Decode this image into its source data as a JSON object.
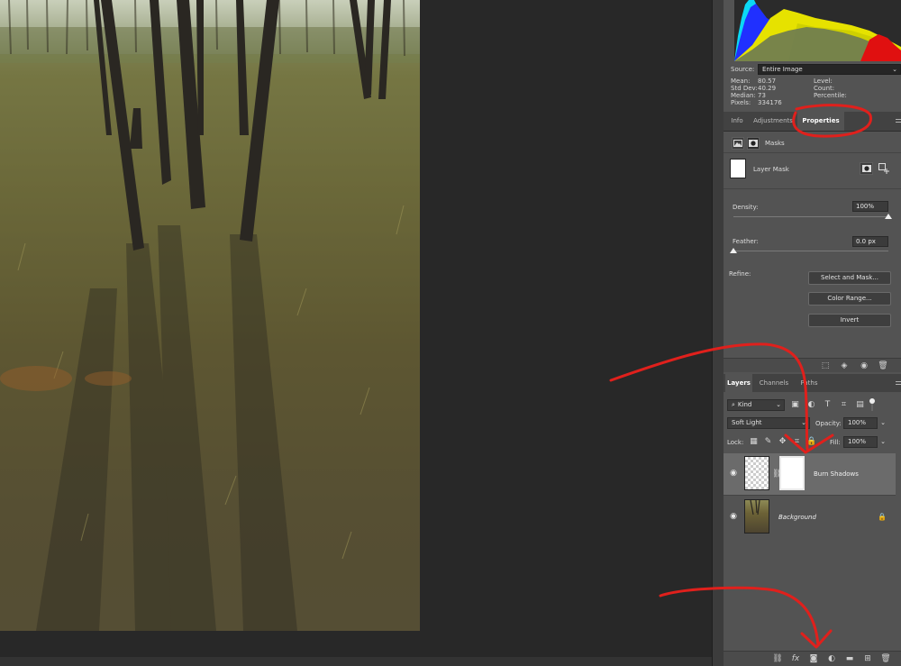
{
  "histogram": {
    "source_label": "Source:",
    "source_value": "Entire Image",
    "stats_left": [
      {
        "label": "Mean:",
        "value": "80.57"
      },
      {
        "label": "Std Dev:",
        "value": "40.29"
      },
      {
        "label": "Median:",
        "value": "73"
      },
      {
        "label": "Pixels:",
        "value": "334176"
      }
    ],
    "stats_right": [
      "Level:",
      "Count:",
      "Percentile:"
    ]
  },
  "top_tabs": {
    "tab1": "Info",
    "tab2": "Adjustments",
    "tab3": "Properties"
  },
  "properties": {
    "masks_label": "Masks",
    "layer_mask_label": "Layer Mask",
    "density_label": "Density:",
    "density_value": "100%",
    "density_fraction": 1.0,
    "feather_label": "Feather:",
    "feather_value": "0.0 px",
    "feather_fraction": 0.0,
    "refine_label": "Refine:",
    "btn_select_mask": "Select and Mask...",
    "btn_color_range": "Color Range...",
    "btn_invert": "Invert"
  },
  "layer_tabs": {
    "tab1": "Layers",
    "tab2": "Channels",
    "tab3": "Paths"
  },
  "layers_panel": {
    "filter_kind": "Kind",
    "blend_mode": "Soft Light",
    "opacity_label": "Opacity:",
    "opacity_value": "100%",
    "lock_label": "Lock:",
    "fill_label": "Fill:",
    "fill_value": "100%",
    "layers": [
      {
        "name": "Burn Shadows",
        "selected": true
      },
      {
        "name": "Background",
        "selected": false
      }
    ]
  },
  "colors": {
    "annotation_red": "#e0201c",
    "panel_bg": "#535353",
    "canvas_bg": "#282828"
  }
}
